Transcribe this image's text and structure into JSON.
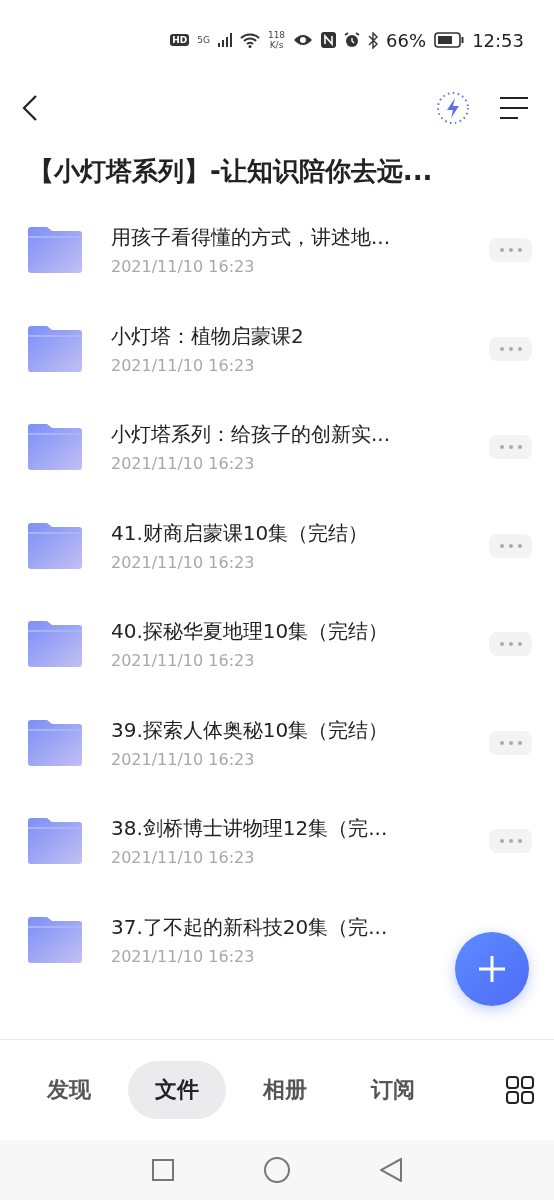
{
  "status_bar": {
    "hd": "HD",
    "network": "5G",
    "speed_value": "118",
    "speed_unit": "K/s",
    "battery": "66%",
    "time": "12:53"
  },
  "header": {
    "title": "【小灯塔系列】-让知识陪你去远..."
  },
  "files": [
    {
      "name": "用孩子看得懂的方式，讲述地...",
      "date": "2021/11/10 16:23"
    },
    {
      "name": "小灯塔：植物启蒙课2",
      "date": "2021/11/10 16:23"
    },
    {
      "name": "小灯塔系列：给孩子的创新实...",
      "date": "2021/11/10 16:23"
    },
    {
      "name": "41.财商启蒙课10集（完结）",
      "date": "2021/11/10 16:23"
    },
    {
      "name": "40.探秘华夏地理10集（完结）",
      "date": "2021/11/10 16:23"
    },
    {
      "name": "39.探索人体奥秘10集（完结）",
      "date": "2021/11/10 16:23"
    },
    {
      "name": "38.剑桥博士讲物理12集（完...",
      "date": "2021/11/10 16:23"
    },
    {
      "name": "37.了不起的新科技20集（完...",
      "date": "2021/11/10 16:23"
    }
  ],
  "tabs": [
    {
      "label": "发现",
      "selected": false
    },
    {
      "label": "文件",
      "selected": true
    },
    {
      "label": "相册",
      "selected": false
    },
    {
      "label": "订阅",
      "selected": false
    }
  ]
}
